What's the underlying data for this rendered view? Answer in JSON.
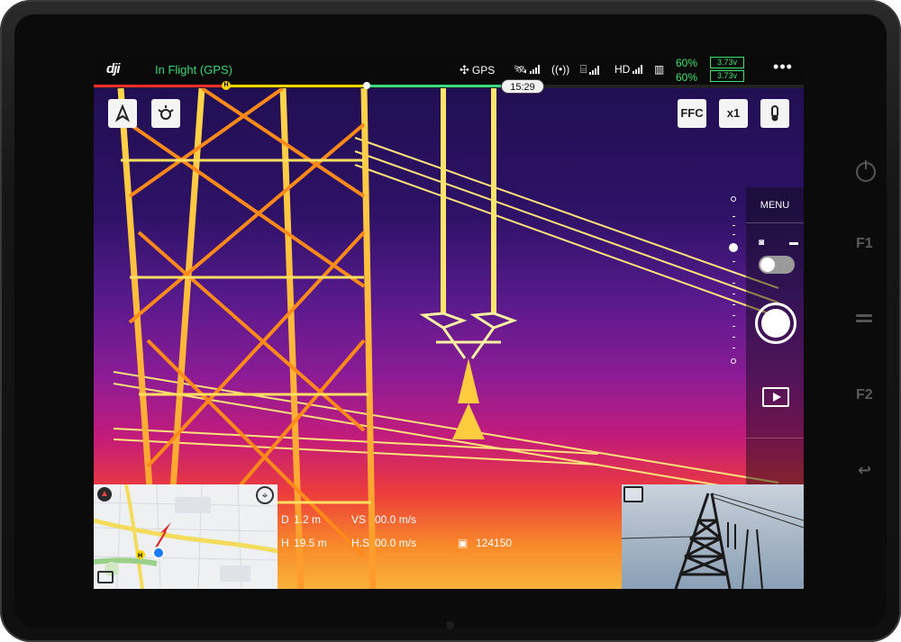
{
  "top_bar": {
    "logo": "dji",
    "flight_status": "In Flight (GPS)",
    "gps_label": "GPS",
    "hd_label": "HD",
    "battery_pct_1": "60%",
    "battery_pct_2": "60%",
    "voltage_1": "3.73v",
    "voltage_2": "3.73v",
    "more_label": "•••"
  },
  "progress": {
    "time_remaining": "15:29",
    "home_marker": "H"
  },
  "camera_controls": {
    "ffc_label": "FFC",
    "zoom_label": "x1",
    "menu_label": "MENU"
  },
  "telemetry": {
    "d_value": "1.2 m",
    "vs_label": "VS",
    "vs_value": "00.0 m/s",
    "h_value": "19.5 m",
    "hs_label": "H.S",
    "hs_value": "00.0 m/s",
    "count_value": "124150"
  },
  "colors": {
    "status_green": "#34d67a",
    "battery_green": "#3fe06b",
    "progress_red": "#ff2c2c",
    "progress_yellow": "#ffd400",
    "progress_green": "#3cd880"
  },
  "icons": [
    "dji-logo",
    "drone-icon",
    "satellite-icon",
    "signal-icon",
    "rc-icon",
    "battery-icon",
    "pilot-icon",
    "light-icon",
    "thermal-palette-icon",
    "camera-icon",
    "video-icon",
    "playback-icon",
    "compass-icon",
    "locate-icon",
    "swap-view-icon"
  ]
}
